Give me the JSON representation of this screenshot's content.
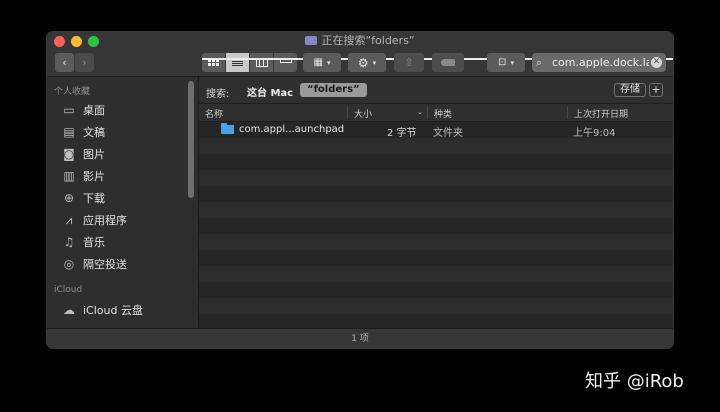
{
  "window": {
    "title": "正在搜索“folders”"
  },
  "toolbar": {
    "nav_back": "‹",
    "nav_forward": "›",
    "search_value": "com.apple.dock.lau",
    "search_icon": "magnifier-icon"
  },
  "sidebar": {
    "favorites_header": "个人收藏",
    "favorites": [
      {
        "label": "桌面",
        "icon": "desktop-icon"
      },
      {
        "label": "文稿",
        "icon": "document-icon"
      },
      {
        "label": "图片",
        "icon": "camera-icon"
      },
      {
        "label": "影片",
        "icon": "film-icon"
      },
      {
        "label": "下载",
        "icon": "download-icon"
      },
      {
        "label": "应用程序",
        "icon": "applications-icon"
      },
      {
        "label": "音乐",
        "icon": "music-icon"
      },
      {
        "label": "隔空投送",
        "icon": "airdrop-icon"
      }
    ],
    "icloud_header": "iCloud",
    "icloud": [
      {
        "label": "iCloud 云盘",
        "icon": "cloud-icon"
      }
    ]
  },
  "scope": {
    "label": "搜索:",
    "this_mac": "这台 Mac",
    "folders": "“folders”",
    "save": "存储",
    "add": "+"
  },
  "columns": {
    "name": "名称",
    "size": "大小",
    "kind": "种类",
    "date": "上次打开日期"
  },
  "files": [
    {
      "name": "com.appl...aunchpad",
      "size": "2 字节",
      "kind": "文件夹",
      "date": "上午9:04",
      "icon": "folder-icon"
    }
  ],
  "status": {
    "count": "1 项"
  },
  "watermark": "知乎 @iRob"
}
